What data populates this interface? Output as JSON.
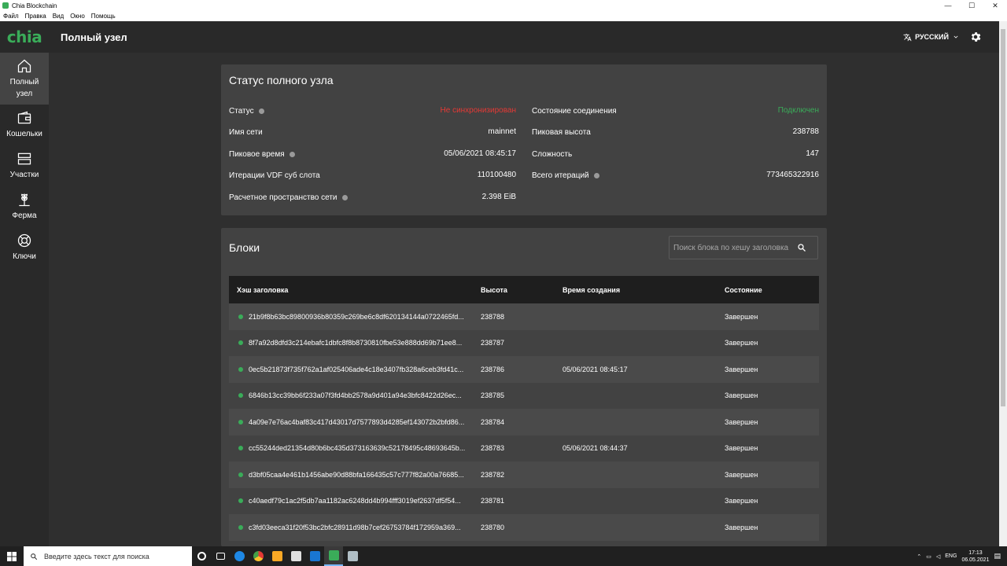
{
  "window": {
    "title": "Chia Blockchain",
    "menu": [
      "Файл",
      "Правка",
      "Вид",
      "Окно",
      "Помощь"
    ]
  },
  "header": {
    "logo": "chia",
    "title": "Полный узел",
    "language": "РУССКИЙ"
  },
  "sidebar": {
    "items": [
      {
        "label": "Полный узел",
        "icon": "home-icon",
        "active": true
      },
      {
        "label": "Кошельки",
        "icon": "wallet-icon"
      },
      {
        "label": "Участки",
        "icon": "plots-icon"
      },
      {
        "label": "Ферма",
        "icon": "farm-icon"
      },
      {
        "label": "Ключи",
        "icon": "keys-icon"
      }
    ]
  },
  "status": {
    "title": "Статус полного узла",
    "rows": [
      {
        "label": "Статус",
        "value": "Не синхронизирован",
        "help": true,
        "color": "#e53935"
      },
      {
        "label": "Имя сети",
        "value": "mainnet"
      },
      {
        "label": "Пиковое время",
        "value": "05/06/2021 08:45:17",
        "help": true
      },
      {
        "label": "Итерации VDF суб слота",
        "value": "110100480"
      },
      {
        "label": "Расчетное пространство сети",
        "value": "2.398 EiB",
        "help": true
      }
    ],
    "rows_right": [
      {
        "label": "Состояние соединения",
        "value": "Подключен",
        "color": "#3aac59"
      },
      {
        "label": "Пиковая высота",
        "value": "238788"
      },
      {
        "label": "Сложность",
        "value": "147"
      },
      {
        "label": "Всего итераций",
        "value": "773465322916",
        "help": true
      }
    ]
  },
  "blocks": {
    "title": "Блоки",
    "search_placeholder": "Поиск блока по хешу заголовка",
    "columns": [
      "Хэш заголовка",
      "Высота",
      "Время создания",
      "Состояние"
    ],
    "rows": [
      {
        "hash": "21b9f8b63bc89800936b80359c269be6c8df620134144a0722465fd...",
        "height": "238788",
        "time": "",
        "state": "Завершен"
      },
      {
        "hash": "8f7a92d8dfd3c214ebafc1dbfc8f8b8730810fbe53e888dd69b71ee8...",
        "height": "238787",
        "time": "",
        "state": "Завершен"
      },
      {
        "hash": "0ec5b21873f735f762a1af025406ade4c18e3407fb328a6ceb3fd41c...",
        "height": "238786",
        "time": "05/06/2021 08:45:17",
        "state": "Завершен"
      },
      {
        "hash": "6846b13cc39bb6f233a07f3fd4bb2578a9d401a94e3bfc8422d26ec...",
        "height": "238785",
        "time": "",
        "state": "Завершен"
      },
      {
        "hash": "4a09e7e76ac4baf83c417d43017d7577893d4285ef143072b2bfd86...",
        "height": "238784",
        "time": "",
        "state": "Завершен"
      },
      {
        "hash": "cc55244ded21354d80b6bc435d373163639c52178495c48693645b...",
        "height": "238783",
        "time": "05/06/2021 08:44:37",
        "state": "Завершен"
      },
      {
        "hash": "d3bf05caa4e461b1456abe90d88bfa166435c57c777f82a00a76685...",
        "height": "238782",
        "time": "",
        "state": "Завершен"
      },
      {
        "hash": "c40aedf79c1ac2f5db7aa1182ac6248dd4b994fff3019ef2637df5f54...",
        "height": "238781",
        "time": "",
        "state": "Завершен"
      },
      {
        "hash": "c3fd03eeca31f20f53bc2bfc28911d98b7cef26753784f172959a369...",
        "height": "238780",
        "time": "",
        "state": "Завершен"
      }
    ]
  },
  "taskbar": {
    "search_placeholder": "Введите здесь текст для поиска",
    "lang": "ENG",
    "time": "17:13",
    "date": "06.05.2021"
  }
}
